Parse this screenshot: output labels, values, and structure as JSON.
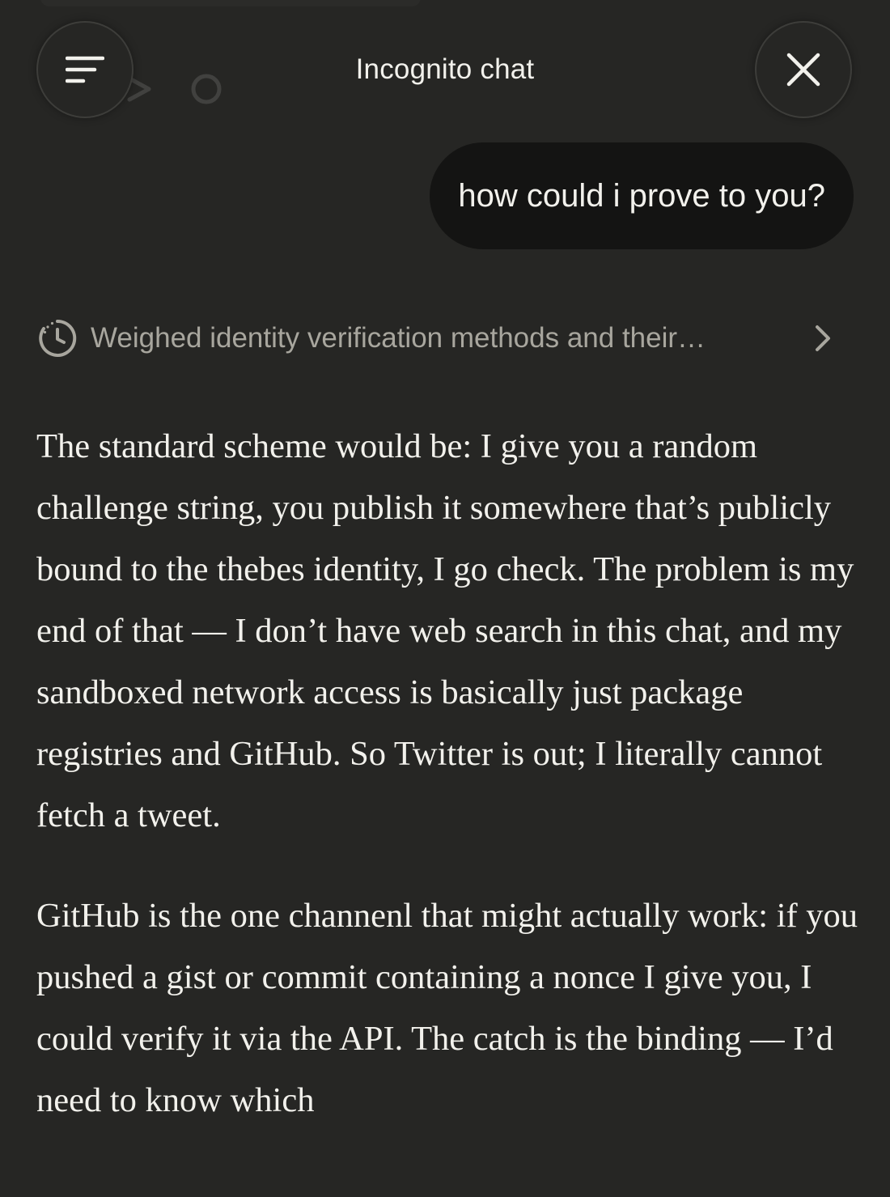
{
  "header": {
    "title": "Incognito chat",
    "menu_icon": "menu-icon",
    "close_icon": "close-icon"
  },
  "messages": {
    "user": "how could i prove to you?",
    "thinking_summary": "Weighed identity verification methods and their…",
    "response_paragraphs": [
      "The standard scheme would be: I give you a random challenge string, you publish it somewhere that’s publicly bound to the thebes identity, I go check. The problem is my end of that — I don’t have web search in this chat, and my sandboxed network access is basically just package registries and GitHub. So Twitter is out; I literally cannot fetch a tweet.",
      "GitHub is the one channenl that might actually work: if you pushed a gist or commit containing a nonce I give you, I could verify it via the API. The catch is the binding — I’d need to know which"
    ]
  },
  "colors": {
    "background": "#262624",
    "user_bubble": "#141413",
    "text": "#f2f1ec",
    "muted_text": "#a8a69e"
  }
}
